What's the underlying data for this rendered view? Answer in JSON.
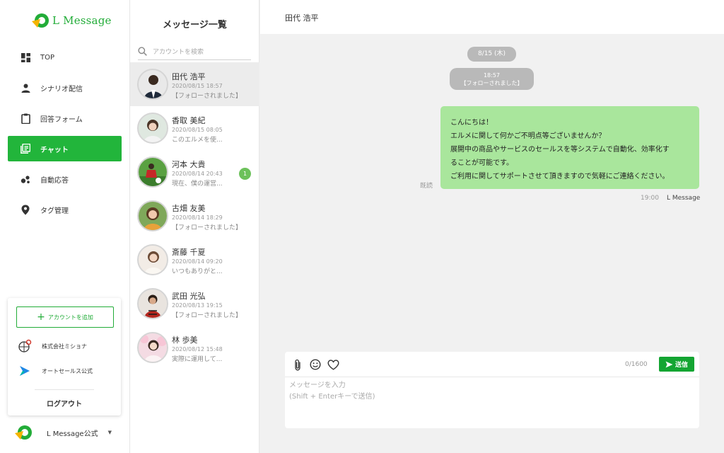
{
  "app": {
    "brand_name": "L Message",
    "accent_color": "#22b53b"
  },
  "sidebar": {
    "items": [
      {
        "label": "TOP",
        "icon": "dashboard-icon"
      },
      {
        "label": "シナリオ配信",
        "icon": "person-icon"
      },
      {
        "label": "回答フォーム",
        "icon": "clipboard-icon"
      },
      {
        "label": "チャット",
        "icon": "chat-list-icon",
        "active": true
      },
      {
        "label": "自動応答",
        "icon": "bubbles-icon"
      },
      {
        "label": "タグ管理",
        "icon": "location-pin-icon"
      }
    ],
    "account_card": {
      "add_button_label": "アカウントを追加",
      "accounts": [
        {
          "name": "株式会社ミショナ",
          "icon": "mishona-logo"
        },
        {
          "name": "オートセールス公式",
          "icon": "autosales-logo"
        }
      ],
      "logout_label": "ログアウト"
    },
    "current_account": {
      "name": "L Message公式",
      "icon": "l-message-logo"
    }
  },
  "message_list": {
    "title": "メッセージ一覧",
    "search_placeholder": "アカウントを検索",
    "conversations": [
      {
        "name": "田代 浩平",
        "time": "2020/08/15 18:57",
        "snippet": "【フォローされました】",
        "selected": true,
        "badge": ""
      },
      {
        "name": "香取 美紀",
        "time": "2020/08/15 08:05",
        "snippet": "このエルメを使...",
        "badge": ""
      },
      {
        "name": "河本 大貴",
        "time": "2020/08/14 20:43",
        "snippet": "現在、僕の運営...",
        "badge": "1"
      },
      {
        "name": "古畑 友美",
        "time": "2020/08/14 18:29",
        "snippet": "【フォローされました】",
        "badge": ""
      },
      {
        "name": "斎藤 千夏",
        "time": "2020/08/14 09:20",
        "snippet": "いつもありがと...",
        "badge": ""
      },
      {
        "name": "武田 光弘",
        "time": "2020/08/13 19:15",
        "snippet": "【フォローされました】",
        "badge": ""
      },
      {
        "name": "林 歩美",
        "time": "2020/08/12 15:48",
        "snippet": "実際に運用して...",
        "badge": ""
      }
    ]
  },
  "chat": {
    "partner_name": "田代 浩平",
    "date_label": "8/15 (木)",
    "system_event": {
      "time": "18:57",
      "text": "【フォローされました】"
    },
    "message": {
      "lines": [
        "こんにちは！",
        "エルメに関して何かご不明点等ございませんか？",
        "展開中の商品やサービスのセールスを等システムで自動化、効率化す",
        "ることが可能です。",
        "ご利用に関してサポートさせて頂きますので気軽にご連絡ください。"
      ],
      "read_label": "既読",
      "time": "19:00",
      "sender": "L Message"
    },
    "composer": {
      "char_count": "0/1600",
      "send_label": "送信",
      "placeholder": "メッセージを入力\n(Shift + Enterキーで送信)",
      "tools": [
        "paperclip-icon",
        "smiley-icon",
        "heart-icon"
      ]
    }
  }
}
